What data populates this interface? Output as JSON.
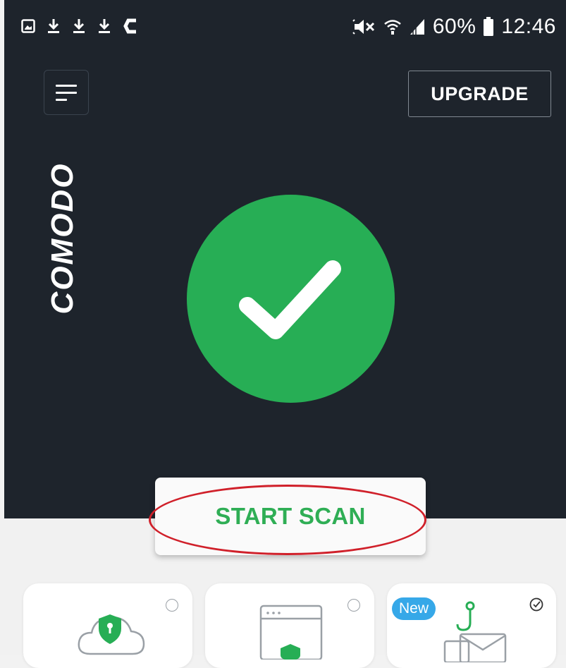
{
  "status_bar": {
    "battery_percent": "60%",
    "time": "12:46",
    "left_icons": [
      "image-icon",
      "download-icon",
      "download-icon",
      "download-icon",
      "ccleaner-icon"
    ],
    "right_icons": [
      "mute-icon",
      "wifi-icon",
      "signal-icon",
      "battery-icon"
    ]
  },
  "header": {
    "menu_icon": "hamburger-icon",
    "upgrade_label": "UPGRADE"
  },
  "brand": {
    "logo_text": "COMODO"
  },
  "status_indicator": {
    "icon": "check-icon",
    "color": "#27ae55"
  },
  "scan_button": {
    "label": "START SCAN",
    "color": "#2fae55",
    "highlight_color": "#d0202a"
  },
  "feature_cards": [
    {
      "icon": "cloud-shield-icon",
      "state": "unchecked"
    },
    {
      "icon": "browser-shield-icon",
      "state": "unchecked"
    },
    {
      "icon": "phishing-email-icon",
      "state": "checked",
      "badge": "New"
    }
  ],
  "colors": {
    "background_dark": "#1e242c",
    "background_light": "#f1f1f1",
    "badge_blue": "#36a8e8"
  }
}
